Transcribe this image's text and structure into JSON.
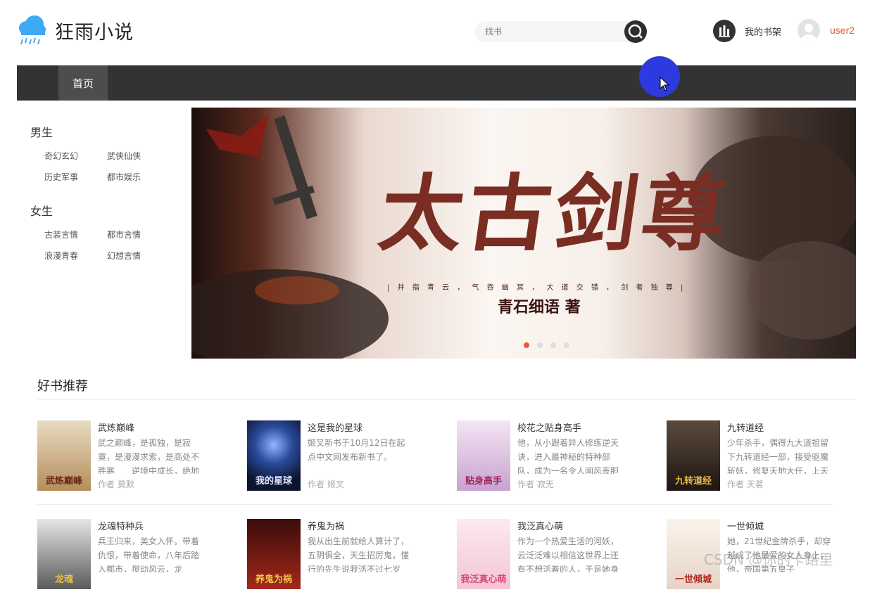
{
  "header": {
    "site_title": "狂雨小说",
    "search_placeholder": "找书",
    "shelf_label": "我的书架",
    "username": "user2"
  },
  "nav": {
    "items": [
      {
        "label": "首页"
      }
    ]
  },
  "sidebar": {
    "groups": [
      {
        "title": "男生",
        "links": [
          "奇幻玄幻",
          "武侠仙侠",
          "历史军事",
          "都市娱乐"
        ]
      },
      {
        "title": "女生",
        "links": [
          "古装言情",
          "都市言情",
          "浪漫青春",
          "幻想言情"
        ]
      }
    ]
  },
  "banner": {
    "title": "太古剑尊",
    "subtitle": "| 并 指 青 云 ， 气 吞 幽 冥 ， 大 道 交 错 ， 剑 者 独 尊 |",
    "author": "青石细语 著",
    "dot_count": 4,
    "active_dot": 0
  },
  "recommend": {
    "title": "好书推荐",
    "books": [
      {
        "name": "武炼巅峰",
        "desc": "武之巅峰，是孤独，是寂寞，是漫漫求索，是高处不胜寒　　逆境中成长，绝地",
        "author": "作者 莫默",
        "cover_text": "武炼巅峰",
        "cover_color": "#c9b089"
      },
      {
        "name": "这是我的星球",
        "desc": "姬叉新书于10月12日在起点中文网发布新书了。",
        "author": "作者 姬叉",
        "cover_text": "我的星球",
        "cover_color": "#1c2c5e"
      },
      {
        "name": "校花之贴身高手",
        "desc": "他，从小跟着异人修练逆天诀，进入最神秘的特种部队，成为一名令人闻风丧胆",
        "author": "作者 寂无",
        "cover_text": "贴身高手",
        "cover_color": "#d8b7d6"
      },
      {
        "name": "九转道经",
        "desc": "少年杀手，偶得九大道祖留下九转道经一部，接受驱魔斩妖，修复天地大任，上天",
        "author": "作者 天茗",
        "cover_text": "九转道经",
        "cover_color": "#2b2118"
      },
      {
        "name": "龙魂特种兵",
        "desc": "兵王归来，美女入怀。带着仇恨，带着使命，八年后踏入都市，搅动风云，龙",
        "author": "",
        "cover_text": "龙魂",
        "cover_color": "#9a9a9a"
      },
      {
        "name": "养鬼为祸",
        "desc": "我从出生前就给人算计了，五阴俱全，天生招厉鬼，懂行的先生说我活不过七岁",
        "author": "",
        "cover_text": "养鬼为祸",
        "cover_color": "#7a1a14"
      },
      {
        "name": "我泛真心萌",
        "desc": "作为一个热爱生活的河妖，云泛泛难以相信这世界上还有不想活着的人，于是她身",
        "author": "",
        "cover_text": "我泛真心萌",
        "cover_color": "#f3dbe1"
      },
      {
        "name": "一世倾城",
        "desc": "她，21世纪金牌杀手，却穿越成了他最爱的女人身上，他，帝国第五皇子",
        "author": "",
        "cover_text": "一世倾城",
        "cover_color": "#f1ece6"
      }
    ]
  },
  "watermark": "CSDN @你的卡路里",
  "colors": {
    "accent": "#e05b3c",
    "nav_bg": "#333333",
    "nav_active": "#4d4d4d"
  }
}
